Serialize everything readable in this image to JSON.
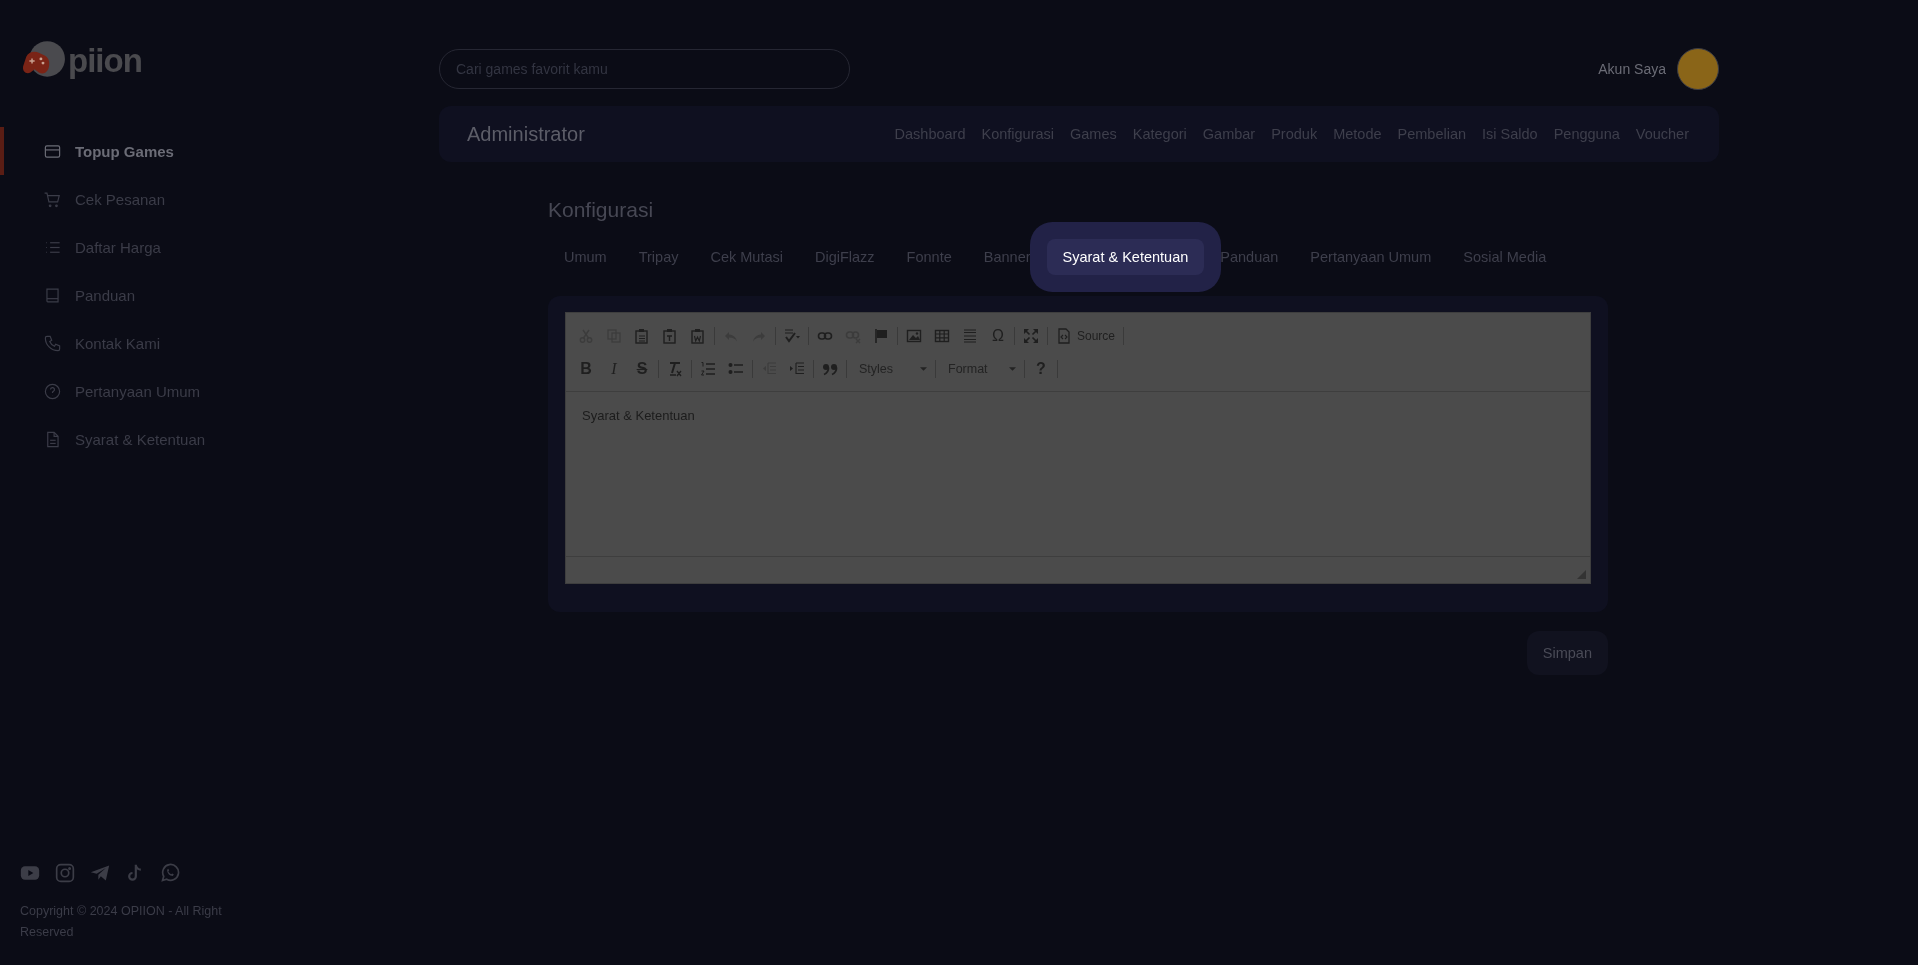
{
  "logo": {
    "text": "piion"
  },
  "sidebar": {
    "items": [
      {
        "label": "Topup Games",
        "selected": true
      },
      {
        "label": "Cek Pesanan",
        "selected": false
      },
      {
        "label": "Daftar Harga",
        "selected": false
      },
      {
        "label": "Panduan",
        "selected": false
      },
      {
        "label": "Kontak Kami",
        "selected": false
      },
      {
        "label": "Pertanyaan Umum",
        "selected": false
      },
      {
        "label": "Syarat & Ketentuan",
        "selected": false
      }
    ],
    "copyright": "Copyright © 2024 OPIION - All Right Reserved"
  },
  "search": {
    "placeholder": "Cari games favorit kamu"
  },
  "account": {
    "label": "Akun Saya"
  },
  "admin_bar": {
    "title": "Administrator",
    "links": [
      "Dashboard",
      "Konfigurasi",
      "Games",
      "Kategori",
      "Gambar",
      "Produk",
      "Metode",
      "Pembelian",
      "Isi Saldo",
      "Pengguna",
      "Voucher"
    ]
  },
  "page_title": "Konfigurasi",
  "tabs": [
    {
      "label": "Umum",
      "selected": false
    },
    {
      "label": "Tripay",
      "selected": false
    },
    {
      "label": "Cek Mutasi",
      "selected": false
    },
    {
      "label": "DigiFlazz",
      "selected": false
    },
    {
      "label": "Fonnte",
      "selected": false
    },
    {
      "label": "Banner",
      "selected": false
    },
    {
      "label": "Syarat & Ketentuan",
      "selected": true
    },
    {
      "label": "Panduan",
      "selected": false
    },
    {
      "label": "Pertanyaan Umum",
      "selected": false
    },
    {
      "label": "Sosial Media",
      "selected": false
    }
  ],
  "editor": {
    "toolbar": [
      [
        [
          {
            "kind": "button",
            "disabled": true
          },
          {
            "kind": "button",
            "disabled": true
          },
          {
            "kind": "button",
            "disabled": false
          },
          {
            "kind": "button",
            "disabled": false
          },
          {
            "kind": "button",
            "disabled": false
          }
        ],
        [
          {
            "kind": "button",
            "disabled": true
          },
          {
            "kind": "button",
            "disabled": true
          }
        ],
        [
          {
            "kind": "button",
            "disabled": false
          }
        ],
        [
          {
            "kind": "button",
            "disabled": false
          },
          {
            "kind": "button",
            "disabled": true
          },
          {
            "kind": "button",
            "disabled": false
          }
        ],
        [
          {
            "kind": "button",
            "disabled": false
          },
          {
            "kind": "button",
            "disabled": false
          },
          {
            "kind": "button",
            "disabled": false
          },
          {
            "kind": "button",
            "label": "Ω",
            "disabled": false
          }
        ],
        [
          {
            "kind": "button",
            "disabled": false
          }
        ],
        [
          {
            "kind": "button",
            "label": "Source",
            "disabled": false
          }
        ]
      ],
      [
        [
          {
            "kind": "button",
            "label": "B",
            "disabled": false
          },
          {
            "kind": "button",
            "label": "I",
            "disabled": false
          },
          {
            "kind": "button",
            "label": "S",
            "disabled": false
          }
        ],
        [
          {
            "kind": "button",
            "disabled": false
          }
        ],
        [
          {
            "kind": "button",
            "disabled": false
          },
          {
            "kind": "button",
            "disabled": false
          }
        ],
        [
          {
            "kind": "button",
            "disabled": true
          },
          {
            "kind": "button",
            "disabled": false
          }
        ],
        [
          {
            "kind": "button",
            "disabled": false
          }
        ],
        [
          {
            "kind": "combo",
            "label": "Styles",
            "disabled": false
          }
        ],
        [
          {
            "kind": "combo",
            "label": "Format",
            "disabled": false
          }
        ],
        [
          {
            "kind": "button",
            "label": "?",
            "disabled": false
          }
        ]
      ]
    ],
    "content": "Syarat & Ketentuan"
  },
  "save_button": "Simpan"
}
